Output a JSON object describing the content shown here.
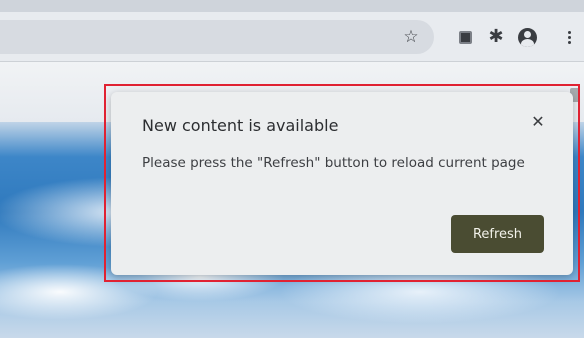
{
  "toolbar": {
    "icons": [
      "star-icon",
      "extension-icon",
      "puzzle-icon",
      "profile-icon",
      "menu-icon"
    ]
  },
  "dialog": {
    "title": "New content is available",
    "close_label": "✕",
    "message": "Please press the \"Refresh\" button to reload current page",
    "refresh_label": "Refresh"
  },
  "colors": {
    "highlight": "#e02232",
    "refresh_button": "#4a4c32",
    "dialog_bg": "#eceeef"
  }
}
